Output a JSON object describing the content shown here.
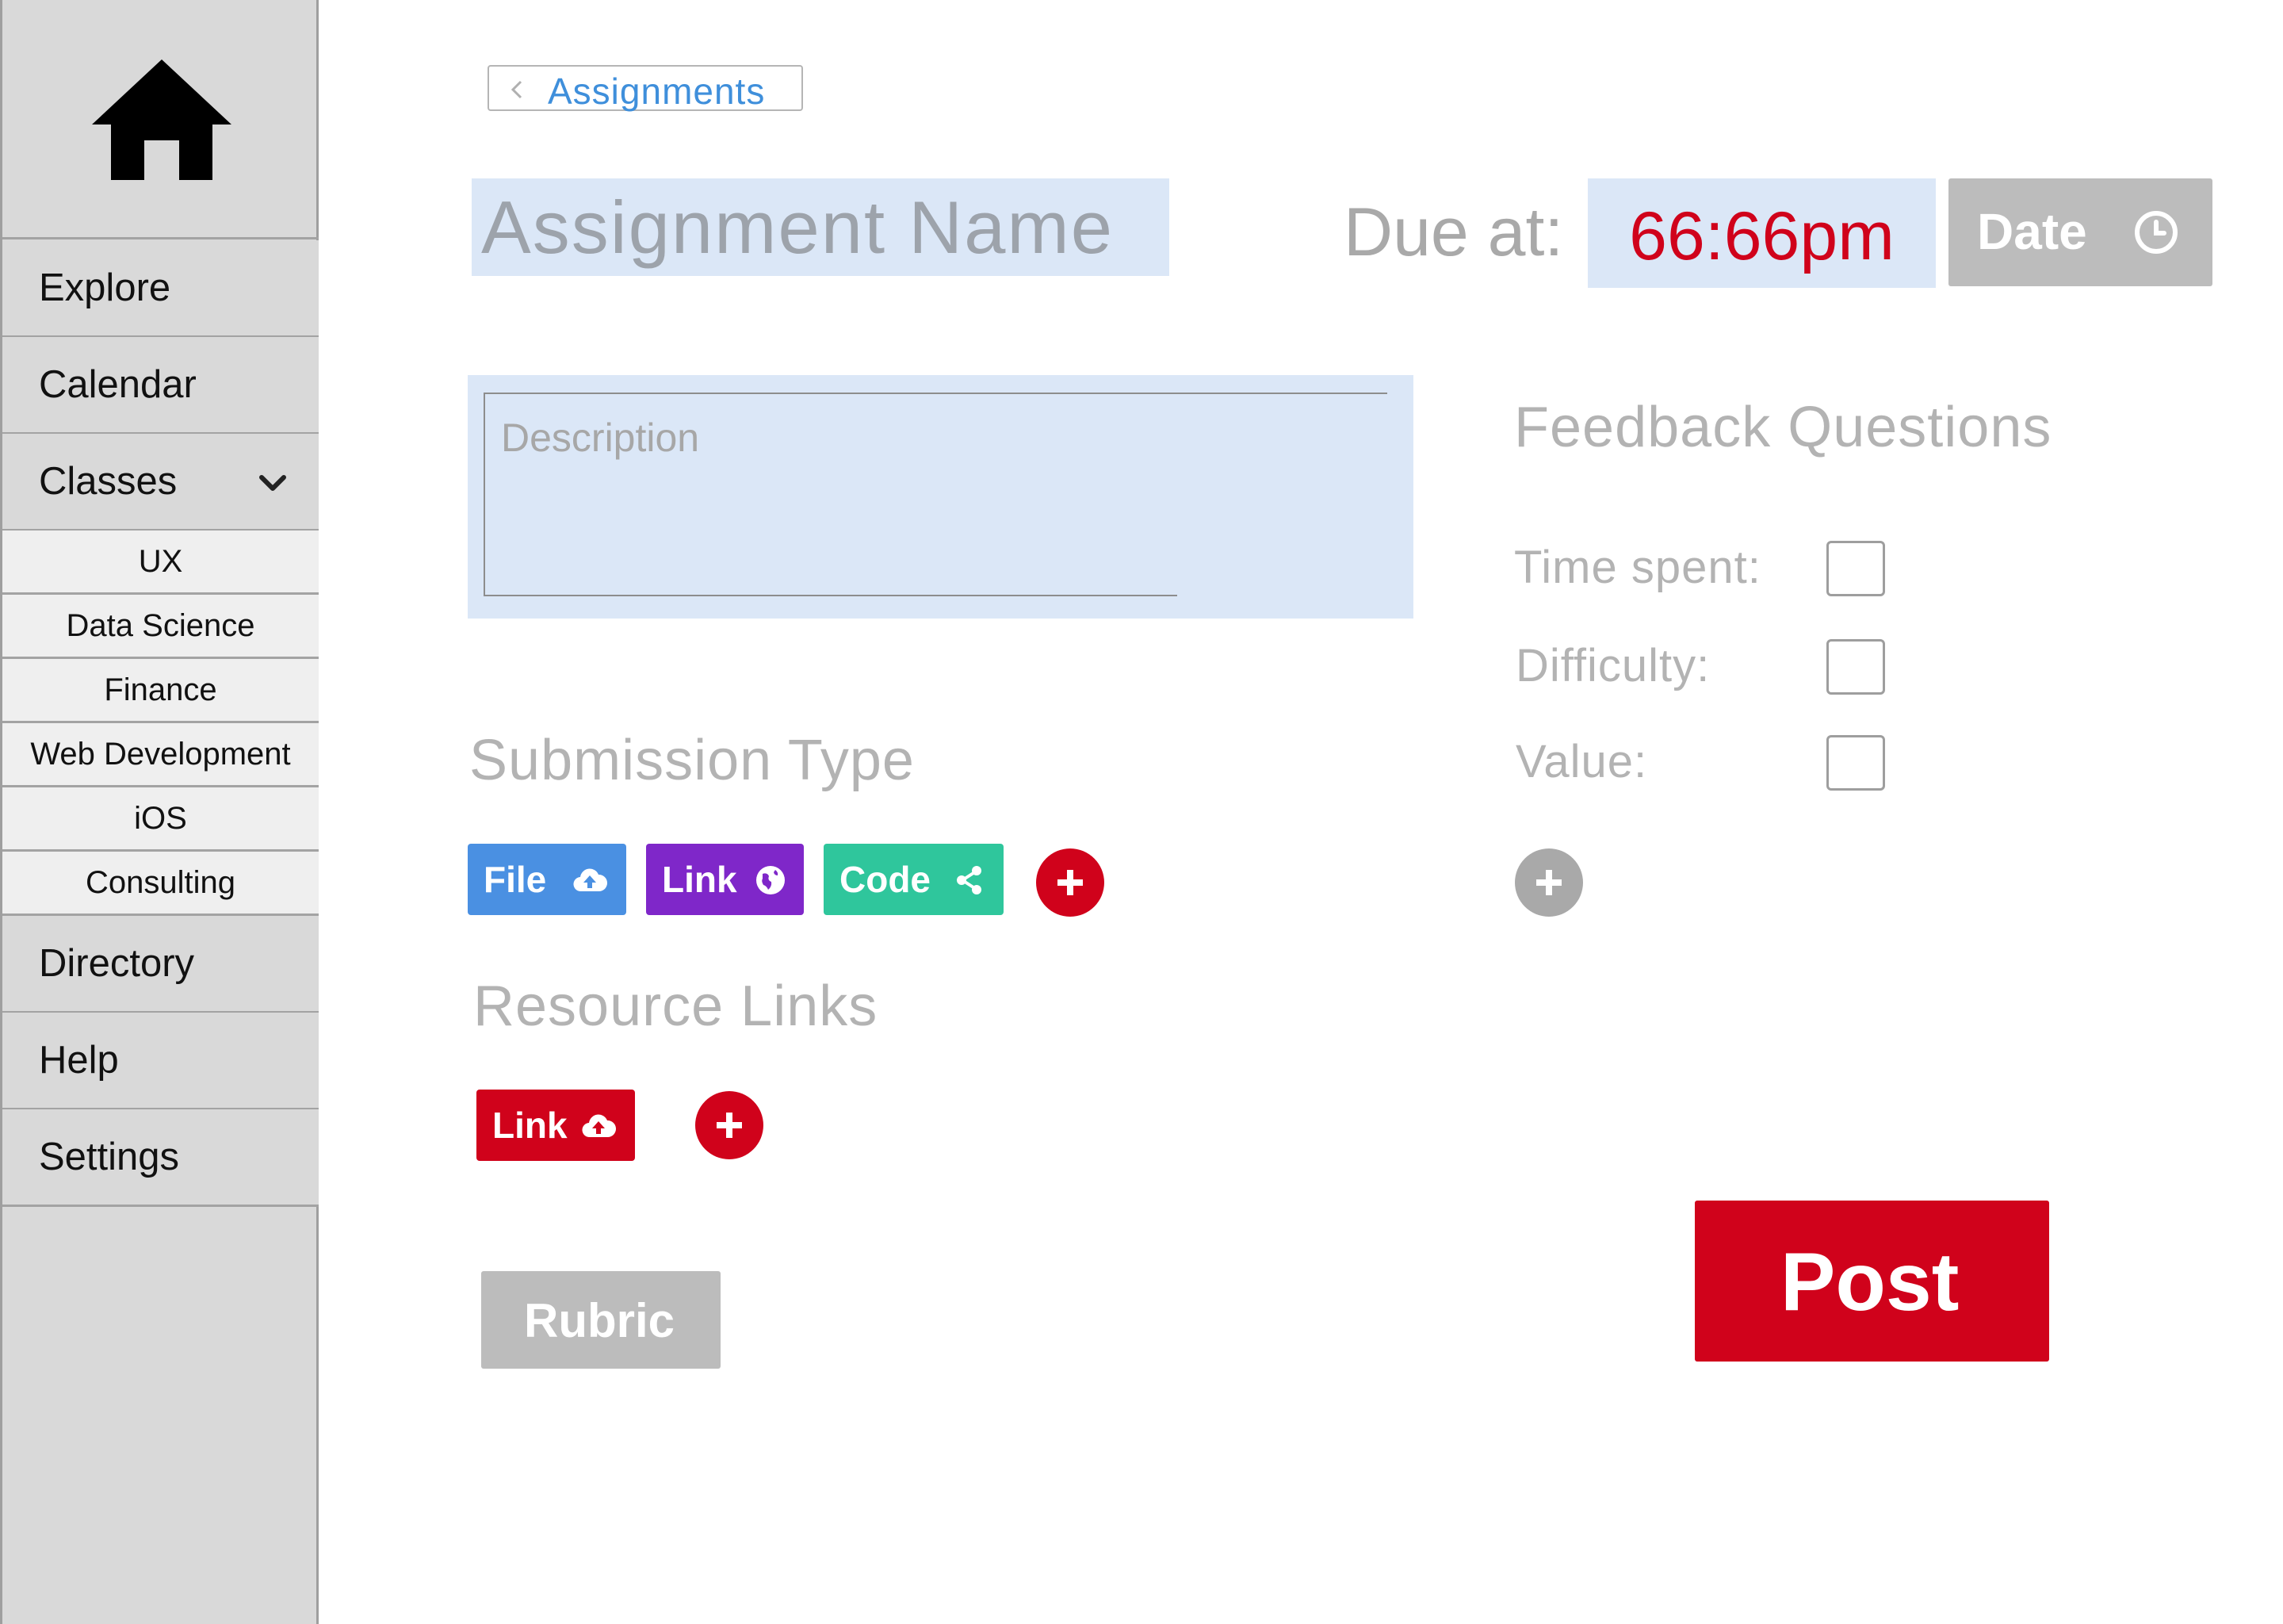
{
  "sidebar": {
    "home_icon": "home-icon",
    "nav_top": [
      {
        "label": "Explore"
      },
      {
        "label": "Calendar"
      },
      {
        "label": "Classes",
        "icon": "chevron-down-icon"
      }
    ],
    "classes": [
      "UX",
      "Data Science",
      "Finance",
      "Web Development",
      "iOS",
      "Consulting"
    ],
    "nav_bottom": [
      {
        "label": "Directory"
      },
      {
        "label": "Help"
      },
      {
        "label": "Settings"
      }
    ]
  },
  "breadcrumb": {
    "back_label": "Assignments"
  },
  "assignment": {
    "name_placeholder": "Assignment Name",
    "due_label": "Due at:",
    "due_time": "66:66pm",
    "date_button": "Date",
    "description_placeholder": "Description"
  },
  "submission": {
    "title": "Submission Type",
    "types": [
      {
        "label": "File",
        "icon": "cloud-upload-icon",
        "color": "#4a90e2"
      },
      {
        "label": "Link",
        "icon": "globe-icon",
        "color": "#7f27c9"
      },
      {
        "label": "Code",
        "icon": "share-icon",
        "color": "#2fc69c"
      }
    ]
  },
  "resources": {
    "title": "Resource Links",
    "links": [
      {
        "label": "Link",
        "icon": "cloud-upload-icon",
        "color": "#d0021b"
      }
    ]
  },
  "feedback": {
    "title": "Feedback Questions",
    "questions": [
      {
        "label": "Time spent:",
        "checked": false
      },
      {
        "label": "Difficulty:",
        "checked": false
      },
      {
        "label": "Value:",
        "checked": false
      }
    ]
  },
  "actions": {
    "rubric": "Rubric",
    "post": "Post"
  },
  "colors": {
    "accent_red": "#d0021b",
    "link_blue": "#3f8fdb",
    "input_bg": "#dbe7f7",
    "muted_gray": "#bcbcbc",
    "sidebar_bg": "#d9d9d9"
  }
}
